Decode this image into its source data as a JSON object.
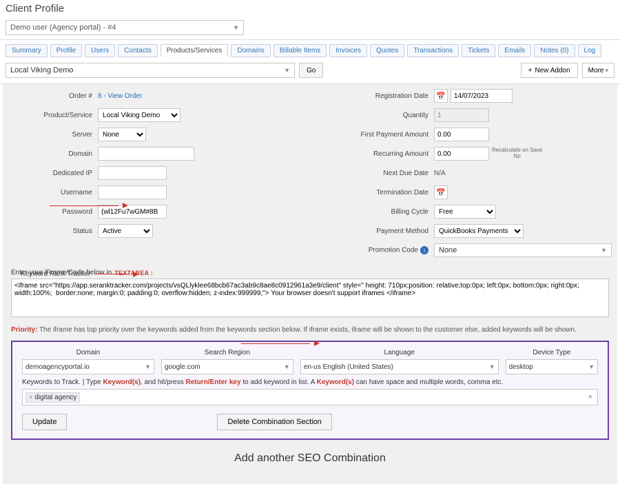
{
  "page_title": "Client Profile",
  "client_select": "Demo user (Agency portal) - #4",
  "tabs": [
    "Summary",
    "Profile",
    "Users",
    "Contacts",
    "Products/Services",
    "Domains",
    "Billable Items",
    "Invoices",
    "Quotes",
    "Transactions",
    "Tickets",
    "Emails",
    "Notes (0)",
    "Log"
  ],
  "active_tab_index": 4,
  "service_select": "Local Viking Demo",
  "go_label": "Go",
  "new_addon_label": "New Addon",
  "more_label": "More",
  "left": {
    "order_label": "Order #",
    "order_value": "8 - View Order",
    "product_label": "Product/Service",
    "product_value": "Local Viking Demo",
    "server_label": "Server",
    "server_value": "None",
    "domain_label": "Domain",
    "domain_value": "",
    "dedip_label": "Dedicated IP",
    "dedip_value": "",
    "username_label": "Username",
    "username_value": "",
    "password_label": "Password",
    "password_value": "(wl12Fu7wGM#8B",
    "status_label": "Status",
    "status_value": "Active"
  },
  "right": {
    "reg_label": "Registration Date",
    "reg_value": "14/07/2023",
    "qty_label": "Quantity",
    "qty_value": "1",
    "fpa_label": "First Payment Amount",
    "fpa_value": "0.00",
    "rec_label": "Recurring Amount",
    "rec_value": "0.00",
    "recalc_label": "Recalculate on Save",
    "recalc_no": "No",
    "nextdue_label": "Next Due Date",
    "nextdue_value": "N/A",
    "term_label": "Termination Date",
    "term_value": "",
    "cycle_label": "Billing Cycle",
    "cycle_value": "Free",
    "pm_label": "Payment Method",
    "pm_value": "QuickBooks Payments",
    "promo_label": "Promotion Code",
    "promo_value": "None"
  },
  "iframe": {
    "label_prefix": "Enter your iFrame/Code below in",
    "label_txa": "TEXTAREA :",
    "value": "<iframe src=\"https://app.seranktracker.com/projects/vsQLlyklee68bcb67ac3ab9c8ae8c0912961a3e9/client\" style=\" height: 710px;position: relative;top:0px; left:0px; bottom:0px; right:0px; width:100%;  border:none; margin:0; padding:0; overflow:hidden; z-index:999999;\"> Your browser doesn't support iframes </iframe>"
  },
  "priority": {
    "label": "Priority:",
    "text": "The iframe has top priority over the keywords added from the keywords section below. If iframe exists, iframe will be shown to the customer else, added keywords will be shown."
  },
  "seo": {
    "section_title": "Keyword Rank Tracker",
    "col_domain": "Domain",
    "col_region": "Search Region",
    "col_lang": "Language",
    "col_device": "Device Type",
    "val_domain": "demoagencyportal.io",
    "val_region": "google.com",
    "val_lang": "en-us English (United States)",
    "val_device": "desktop",
    "kw_hint_1": "Keywords to Track. | Type ",
    "kw_hint_kw": "Keyword(s)",
    "kw_hint_2": ", and hit/press ",
    "kw_hint_enter": "Return/Enter key",
    "kw_hint_3": " to add keyword in list. A ",
    "kw_hint_4": " can have space and multiple words, comma etc.",
    "tag": "digital agency",
    "update_btn": "Update",
    "delete_btn": "Delete Combination Section"
  },
  "add_seo_label": "Add another SEO Combination"
}
